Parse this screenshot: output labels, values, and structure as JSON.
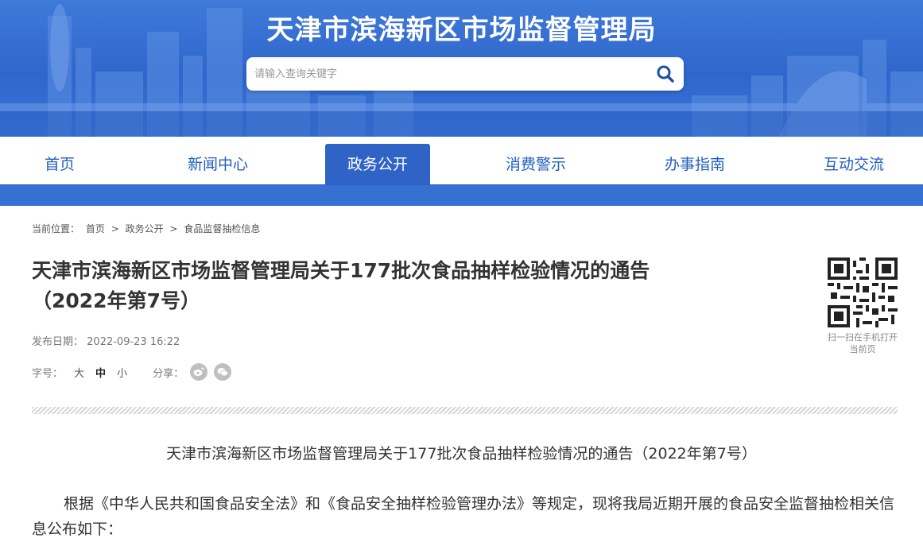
{
  "header": {
    "site_title": "天津市滨海新区市场监督管理局",
    "search_placeholder": "请输入查询关键字"
  },
  "nav": {
    "items": [
      {
        "label": "首页"
      },
      {
        "label": "新闻中心"
      },
      {
        "label": "政务公开",
        "active": true
      },
      {
        "label": "消费警示"
      },
      {
        "label": "办事指南"
      },
      {
        "label": "互动交流"
      }
    ]
  },
  "breadcrumb": {
    "prefix": "当前位置：",
    "items": [
      "首页",
      "政务公开",
      "食品监督抽检信息"
    ],
    "separator": ">"
  },
  "article": {
    "title_line1": "天津市滨海新区市场监督管理局关于177批次食品抽样检验情况的通告",
    "title_line2": "（2022年第7号）",
    "date_label": "发布日期：",
    "date": "2022-09-23 16:22",
    "font_size_label": "字号：",
    "font_sizes": [
      "大",
      "中",
      "小"
    ],
    "share_label": "分享：",
    "share_icons": [
      "weibo-icon",
      "wechat-icon"
    ],
    "qr_caption": "扫一扫在手机打开当前页",
    "body_title": "天津市滨海新区市场监督管理局关于177批次食品抽样检验情况的通告（2022年第7号）",
    "body_paragraph": "根据《中华人民共和国食品安全法》和《食品安全抽样检验管理办法》等规定，现将我局近期开展的食品安全监督抽检相关信息公布如下："
  },
  "colors": {
    "brand_blue": "#2f63c6",
    "nav_text": "#1f5fbf"
  }
}
